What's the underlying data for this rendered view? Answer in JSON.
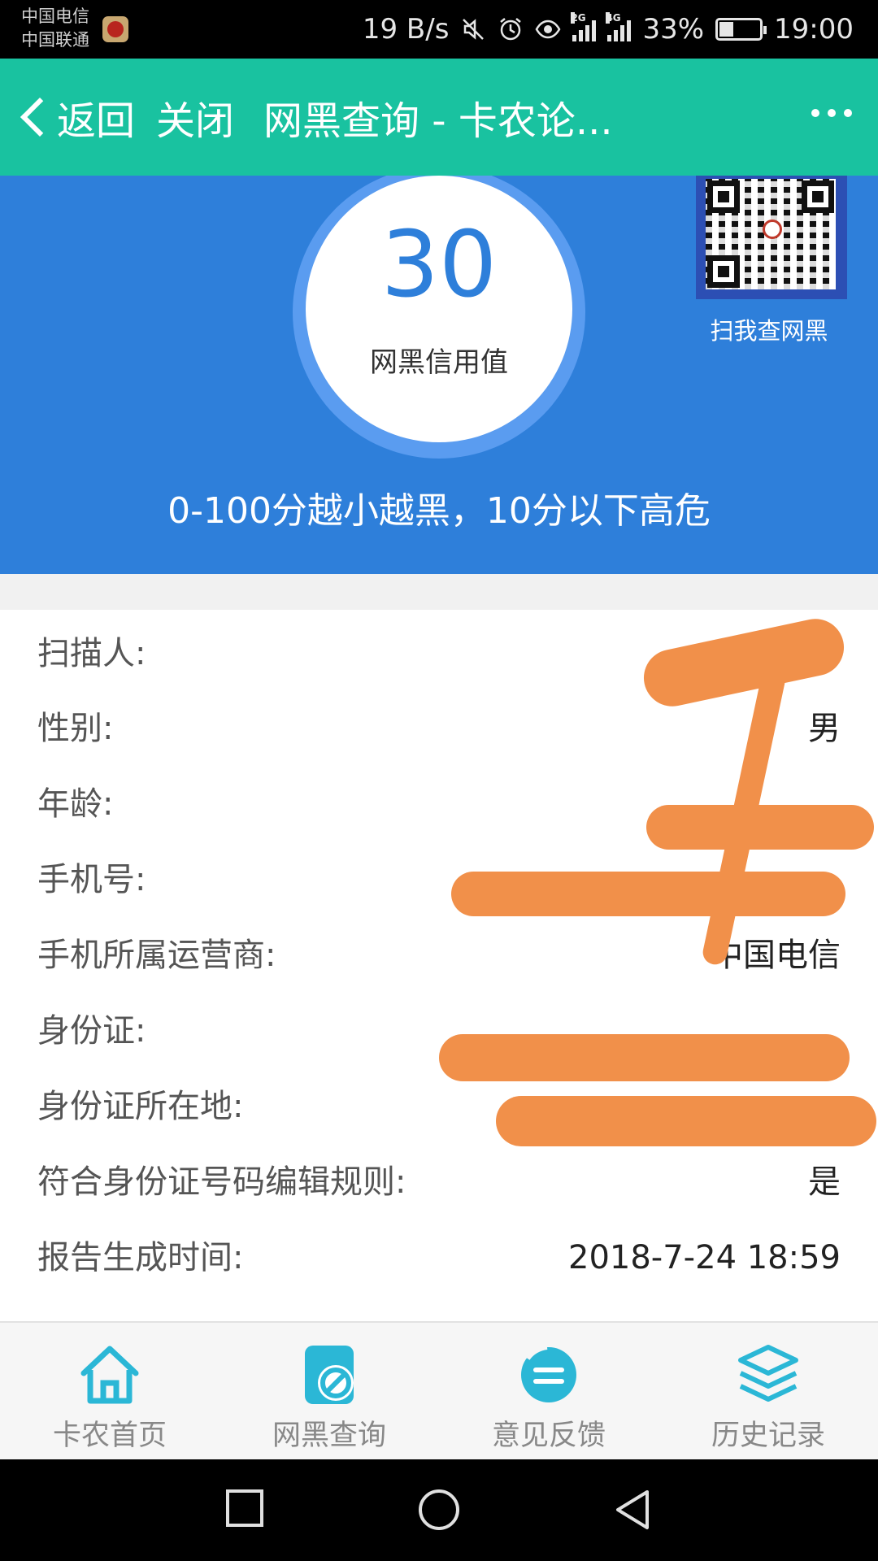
{
  "status_bar": {
    "carrier_1": "中国电信",
    "carrier_2": "中国联通",
    "net_speed": "19 B/s",
    "network_1": "2G",
    "network_2": "4G",
    "battery": "33%",
    "battery_level": 0.33,
    "time": "19:00"
  },
  "title_bar": {
    "back_label": "返回",
    "close_label": "关闭",
    "title": "网黑查询 - 卡农论...",
    "accent_color": "#19c2a0"
  },
  "score": {
    "value": "30",
    "label": "网黑信用值",
    "qr_label": "扫我查网黑",
    "note": "0-100分越小越黑，10分以下高危",
    "header_color": "#2e7fda"
  },
  "info": {
    "rows": [
      {
        "label": "扫描人:",
        "value": "",
        "redacted": true
      },
      {
        "label": "性别:",
        "value": "男",
        "redacted": true
      },
      {
        "label": "年龄:",
        "value": "",
        "redacted": true
      },
      {
        "label": "手机号:",
        "value": "",
        "redacted": true
      },
      {
        "label": "手机所属运营商:",
        "value": "中国电信",
        "redacted": false
      },
      {
        "label": "身份证:",
        "value": "",
        "redacted": true
      },
      {
        "label": "身份证所在地:",
        "value": "",
        "redacted": true
      },
      {
        "label": "符合身份证号码编辑规则:",
        "value": "是",
        "redacted": false
      },
      {
        "label": "报告生成时间:",
        "value": "2018-7-24 18:59",
        "redacted": false
      }
    ],
    "redaction_color": "#f1904a"
  },
  "tabs": [
    {
      "label": "卡农首页",
      "icon": "home-icon"
    },
    {
      "label": "网黑查询",
      "icon": "blacklist-query-icon"
    },
    {
      "label": "意见反馈",
      "icon": "feedback-icon"
    },
    {
      "label": "历史记录",
      "icon": "layers-history-icon"
    }
  ],
  "nav_bar": {
    "buttons": [
      "recent-apps",
      "home",
      "back"
    ]
  }
}
